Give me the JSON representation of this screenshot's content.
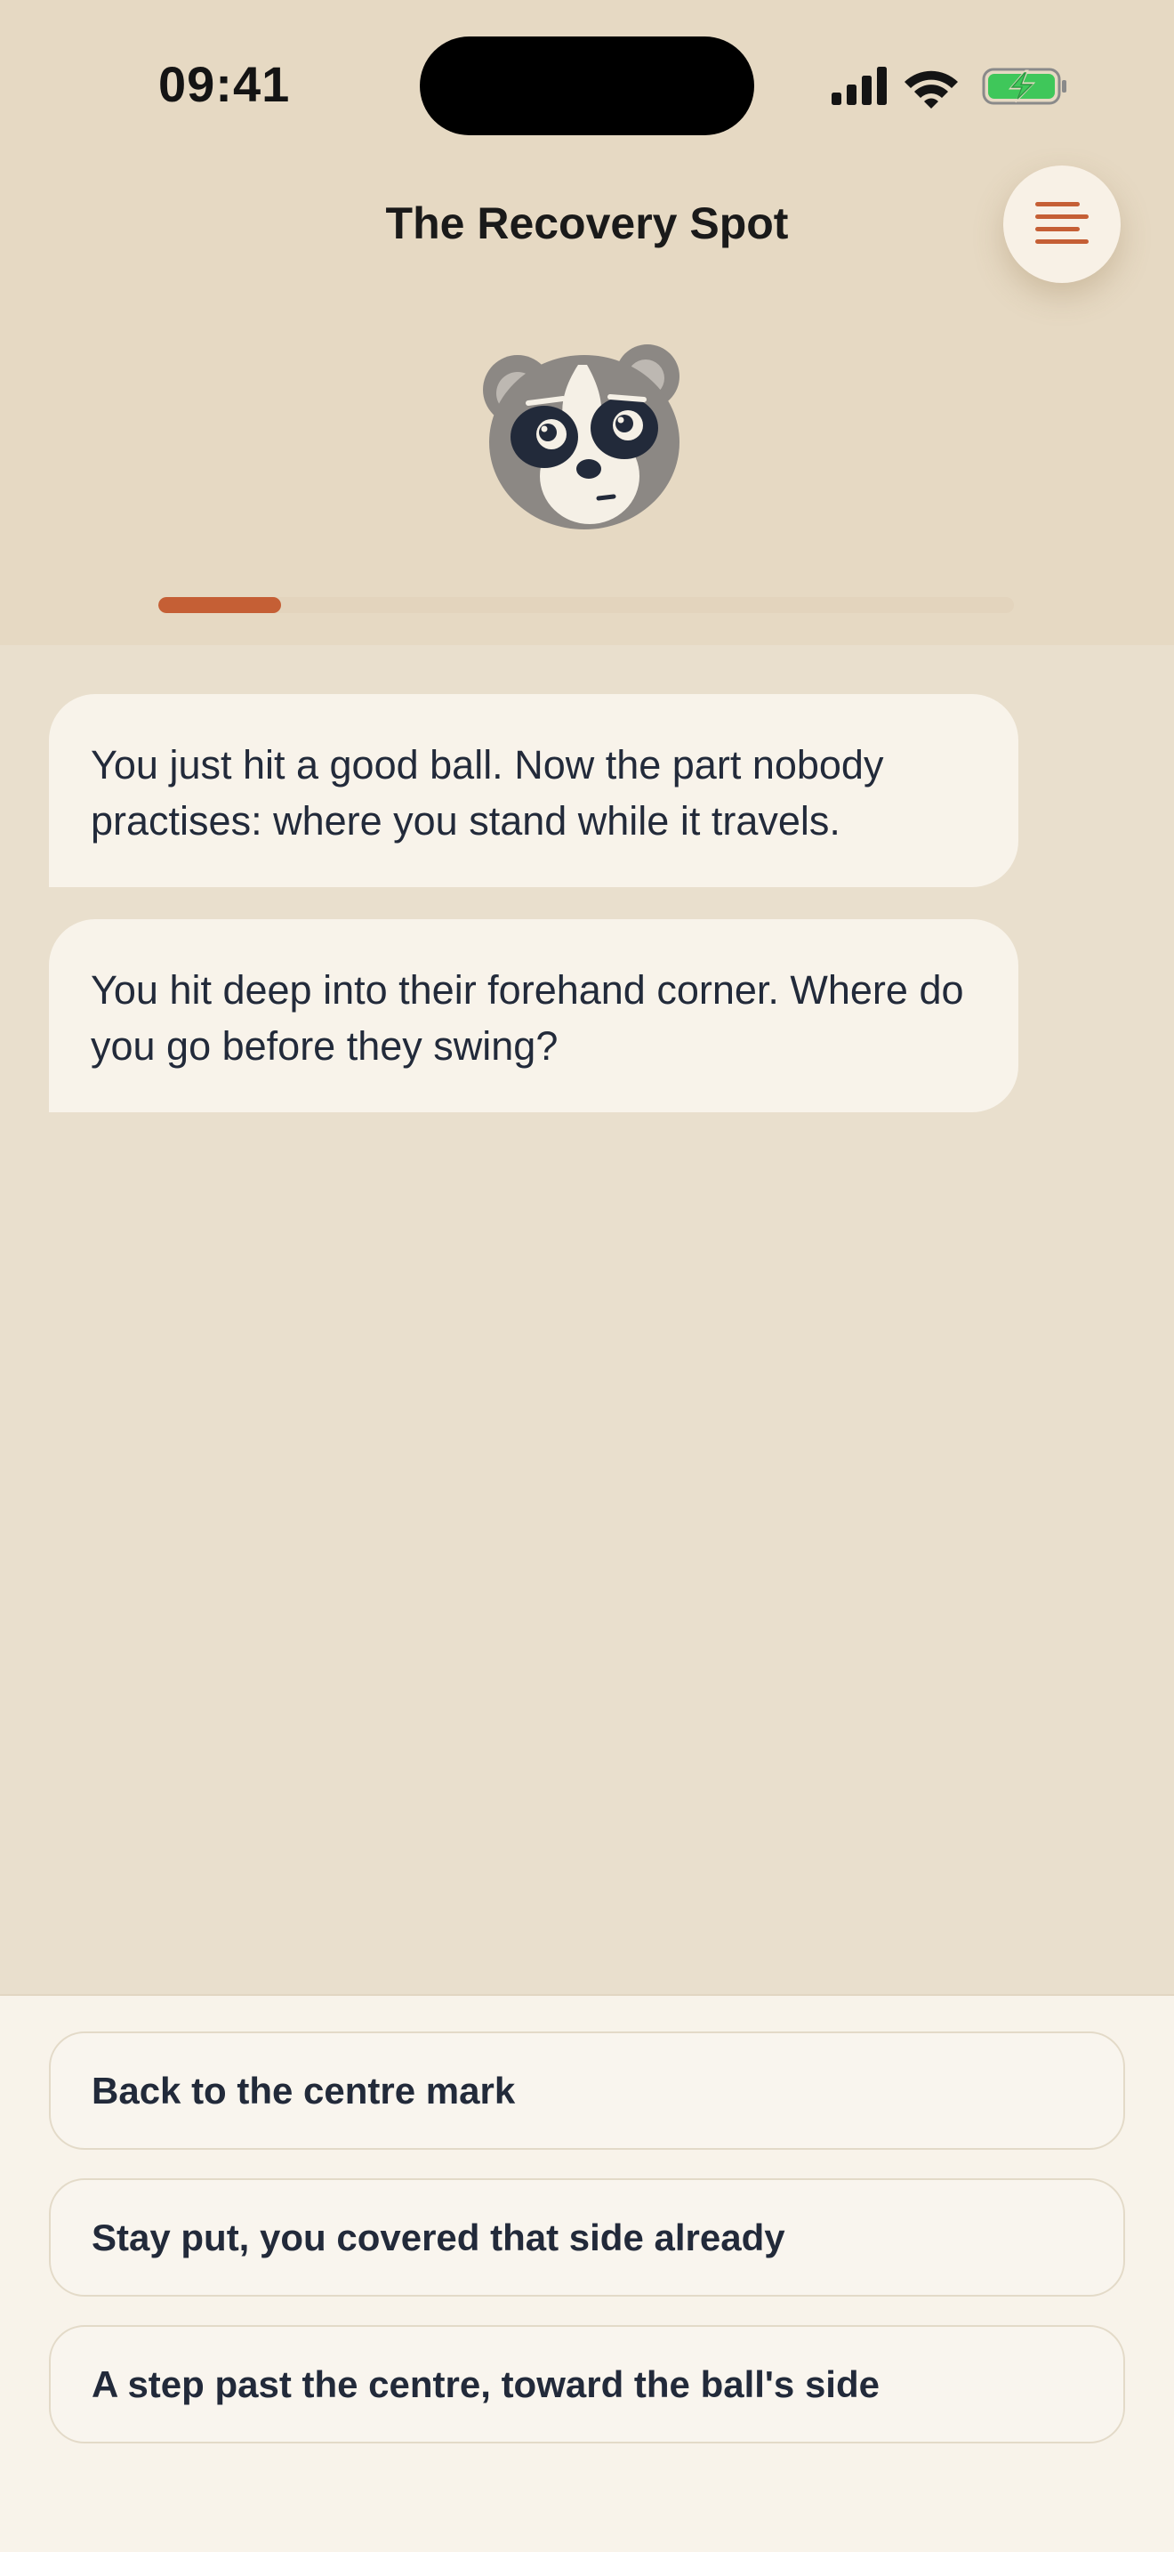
{
  "status_bar": {
    "time": "09:41"
  },
  "header": {
    "title": "The Recovery Spot",
    "menu_icon": "hamburger-menu-icon",
    "mascot_icon": "raccoon-mascot-icon"
  },
  "progress": {
    "fraction": 0.143
  },
  "chat": {
    "messages": [
      {
        "text": "You just hit a good ball. Now the part nobody practises: where you stand while it travels."
      },
      {
        "text": "You hit deep into their forehand corner. Where do you go before they swing?"
      }
    ]
  },
  "answers": {
    "options": [
      {
        "label": "Back to the centre mark"
      },
      {
        "label": "Stay put, you covered that side already"
      },
      {
        "label": "A step past the centre, toward the ball's side"
      }
    ]
  },
  "colors": {
    "header_bg": "#e6d9c3",
    "chat_bg": "#e9dfcd",
    "accent": "#c55f35",
    "bubble_bg": "#f8f3ea",
    "text": "#222a3a",
    "battery_green": "#3fc75a"
  }
}
